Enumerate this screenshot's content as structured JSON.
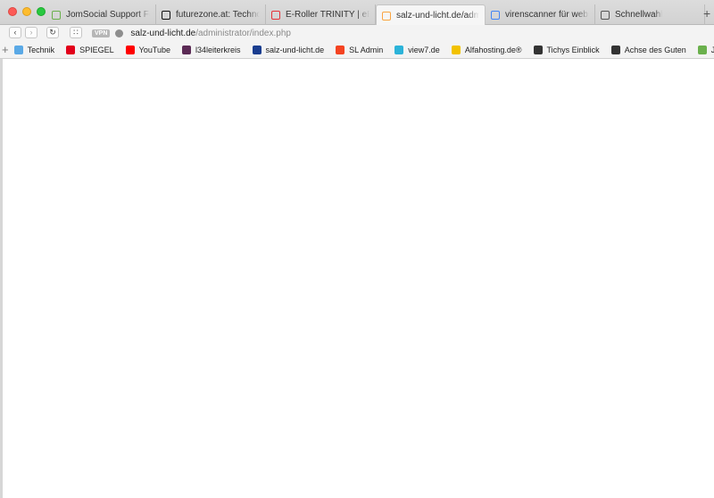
{
  "tabs": [
    {
      "title": "JomSocial Support Forum - N",
      "icon": "jomsocial-icon",
      "color": "#6ab04c",
      "active": false
    },
    {
      "title": "futurezone.at: Technology N",
      "icon": "futurezone-icon",
      "color": "#111111",
      "active": false
    },
    {
      "title": "E-Roller TRINITY | eBay",
      "icon": "ebay-icon",
      "color": "#e53238",
      "active": false
    },
    {
      "title": "salz-und-licht.de/administra",
      "icon": "joomla-icon",
      "color": "#f9a541",
      "active": true
    },
    {
      "title": "virenscanner für webserver",
      "icon": "google-icon",
      "color": "#4285f4",
      "active": false
    },
    {
      "title": "Schnellwahl",
      "icon": "speed-dial-icon",
      "color": "#555555",
      "active": false
    }
  ],
  "toolbar": {
    "vpn_label": "VPN",
    "url_host": "salz-und-licht.de",
    "url_path": "/administrator/index.php"
  },
  "bookmarks": [
    {
      "label": "Technik",
      "icon": "folder-icon",
      "color": "#5aa9e6"
    },
    {
      "label": "SPIEGEL",
      "icon": "spiegel-icon",
      "color": "#e2001a"
    },
    {
      "label": "YouTube",
      "icon": "youtube-icon",
      "color": "#ff0000"
    },
    {
      "label": "l34leiterkreis",
      "icon": "l34-icon",
      "color": "#5b2a55"
    },
    {
      "label": "salz-und-licht.de",
      "icon": "sul-icon",
      "color": "#1a3d8f"
    },
    {
      "label": "SL Admin",
      "icon": "joomla-icon",
      "color": "#f44321"
    },
    {
      "label": "view7.de",
      "icon": "view7-icon",
      "color": "#2bb3d9"
    },
    {
      "label": "Alfahosting.de®",
      "icon": "alfahosting-icon",
      "color": "#f2c200"
    },
    {
      "label": "Tichys Einblick",
      "icon": "tichy-icon",
      "color": "#333333"
    },
    {
      "label": "Achse des Guten",
      "icon": "achse-icon",
      "color": "#333333"
    },
    {
      "label": "JomSocial",
      "icon": "jomsocial-icon",
      "color": "#6ab04c"
    }
  ]
}
